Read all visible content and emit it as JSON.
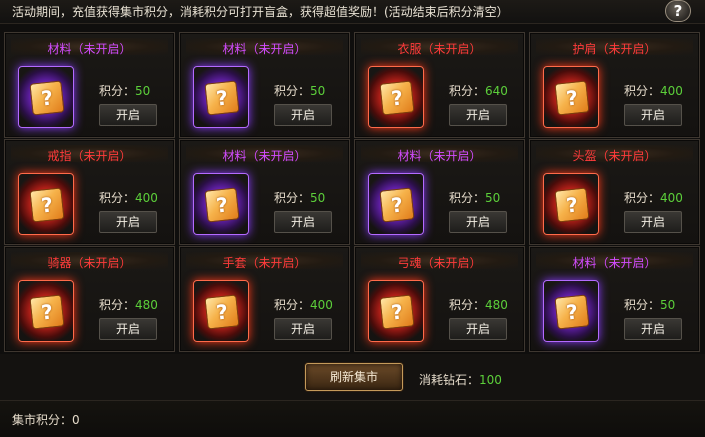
{
  "header": {
    "notice": "活动期间，充值获得集市积分，消耗积分可打开盲盒，获得超值奖励！(活动结束后积分清空）",
    "help_icon": "?"
  },
  "common": {
    "points_label": "积分：",
    "open_label": "开启",
    "box_glyph": "?"
  },
  "colors": {
    "title_purple": "#d24cff",
    "title_red": "#ff3b3b",
    "points_green": "#5ccf3a"
  },
  "cards": [
    {
      "title": "材料（未开启）",
      "points": "50",
      "rarity": "purple"
    },
    {
      "title": "材料（未开启）",
      "points": "50",
      "rarity": "purple"
    },
    {
      "title": "衣服（未开启）",
      "points": "640",
      "rarity": "red"
    },
    {
      "title": "护肩（未开启）",
      "points": "400",
      "rarity": "red"
    },
    {
      "title": "戒指（未开启）",
      "points": "400",
      "rarity": "red"
    },
    {
      "title": "材料（未开启）",
      "points": "50",
      "rarity": "purple"
    },
    {
      "title": "材料（未开启）",
      "points": "50",
      "rarity": "purple"
    },
    {
      "title": "头盔（未开启）",
      "points": "400",
      "rarity": "red"
    },
    {
      "title": "骑器（未开启）",
      "points": "480",
      "rarity": "red"
    },
    {
      "title": "手套（未开启）",
      "points": "400",
      "rarity": "red"
    },
    {
      "title": "弓魂（未开启）",
      "points": "480",
      "rarity": "red"
    },
    {
      "title": "材料（未开启）",
      "points": "50",
      "rarity": "purple"
    }
  ],
  "footer": {
    "refresh_label": "刷新集市",
    "cost_label": "消耗钻石：",
    "cost_value": "100",
    "market_points_label": "集市积分：",
    "market_points_value": "0"
  }
}
